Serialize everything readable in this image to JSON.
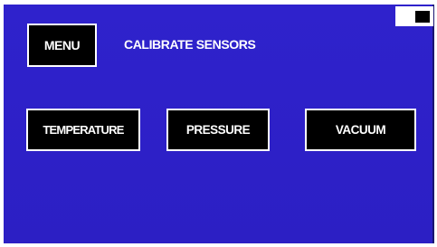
{
  "header": {
    "menu_label": "MENU",
    "title": "CALIBRATE SENSORS"
  },
  "status": {
    "battery_icon": "battery-icon"
  },
  "sensors": [
    {
      "label": "TEMPERATURE"
    },
    {
      "label": "PRESSURE"
    },
    {
      "label": "VACUUM"
    }
  ],
  "colors": {
    "screen_background": "#2f22cc",
    "button_background": "#000000",
    "button_border": "#ffffff",
    "text": "#ffffff"
  }
}
